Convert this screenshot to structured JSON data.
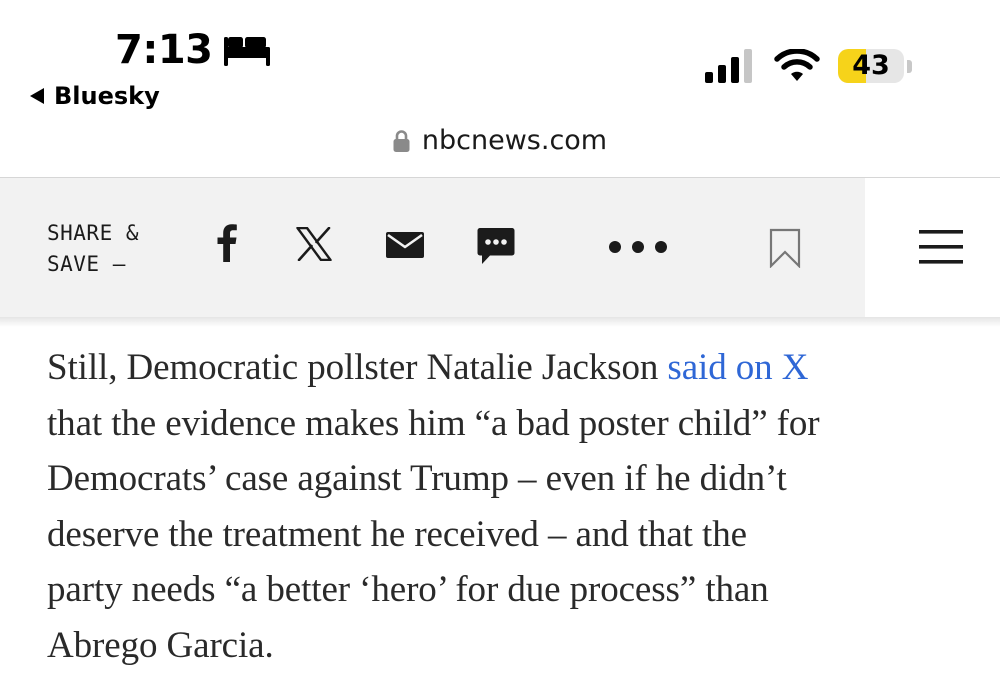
{
  "status_bar": {
    "time": "7:13",
    "back_app_label": "Bluesky",
    "battery_percent": 43,
    "battery_text": "43",
    "icons": [
      "bed-icon",
      "signal-icon",
      "wifi-icon",
      "battery-icon"
    ]
  },
  "browser": {
    "url": "nbcnews.com",
    "secure_icon": "lock-icon"
  },
  "share_bar": {
    "label_line1": "SHARE &",
    "label_line2": "SAVE —",
    "actions": [
      {
        "name": "facebook",
        "icon": "facebook-icon"
      },
      {
        "name": "x",
        "icon": "x-icon"
      },
      {
        "name": "email",
        "icon": "email-icon"
      },
      {
        "name": "sms",
        "icon": "message-icon"
      },
      {
        "name": "more",
        "icon": "more-dots-icon"
      },
      {
        "name": "bookmark",
        "icon": "bookmark-icon"
      }
    ],
    "menu_icon": "hamburger-menu-icon"
  },
  "article": {
    "line1_before_link": "Still, Democratic pollster Natalie Jackson ",
    "line1_link": "said on X",
    "line2": "that the evidence makes him “a bad poster child” for",
    "line3": "Democrats’ case against Trump – even if he didn’t",
    "line4": "deserve the treatment he received – and that the",
    "line5": "party needs “a better ‘hero’ for due process” than",
    "line6": "Abrego Garcia."
  },
  "colors": {
    "link": "#2f67d6",
    "battery_fill": "#f6d31a",
    "toolbar_bg": "#f2f2f2",
    "body_text": "#2a2a2a"
  }
}
